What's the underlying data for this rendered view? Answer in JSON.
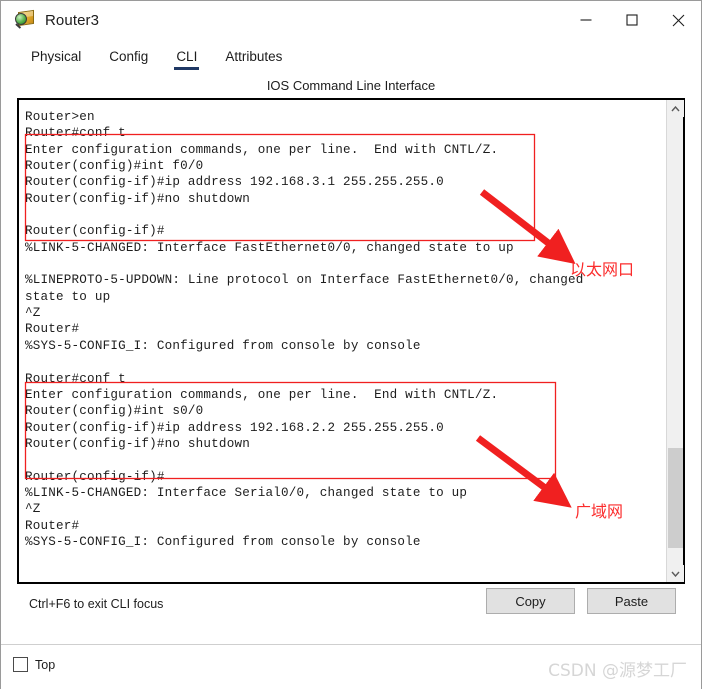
{
  "window": {
    "title": "Router3",
    "icon": "inspect-device-icon",
    "controls": {
      "minimize": "minimize-icon",
      "maximize": "maximize-icon",
      "close": "close-icon"
    }
  },
  "tabs": [
    {
      "label": "Physical",
      "active": false
    },
    {
      "label": "Config",
      "active": false
    },
    {
      "label": "CLI",
      "active": true
    },
    {
      "label": "Attributes",
      "active": false
    }
  ],
  "panel": {
    "title": "IOS Command Line Interface"
  },
  "terminal": {
    "text": "Router>en\nRouter#conf t\nEnter configuration commands, one per line.  End with CNTL/Z.\nRouter(config)#int f0/0\nRouter(config-if)#ip address 192.168.3.1 255.255.255.0\nRouter(config-if)#no shutdown\n\nRouter(config-if)#\n%LINK-5-CHANGED: Interface FastEthernet0/0, changed state to up\n\n%LINEPROTO-5-UPDOWN: Line protocol on Interface FastEthernet0/0, changed\nstate to up\n^Z\nRouter#\n%SYS-5-CONFIG_I: Configured from console by console\n\nRouter#conf t\nEnter configuration commands, one per line.  End with CNTL/Z.\nRouter(config)#int s0/0\nRouter(config-if)#ip address 192.168.2.2 255.255.255.0\nRouter(config-if)#no shutdown\n\nRouter(config-if)#\n%LINK-5-CHANGED: Interface Serial0/0, changed state to up\n^Z\nRouter#\n%SYS-5-CONFIG_I: Configured from console by console\n"
  },
  "scrollbar": {
    "up_arrow": "chevron-up-icon",
    "down_arrow": "chevron-down-icon"
  },
  "annotations": {
    "accent_color": "#fb2c2c",
    "items": [
      {
        "label": "以太网口",
        "name": "annotation-ethernet-port"
      },
      {
        "label": "广域网",
        "name": "annotation-wan"
      }
    ]
  },
  "bottom": {
    "hint": "Ctrl+F6 to exit CLI focus",
    "copy_label": "Copy",
    "paste_label": "Paste"
  },
  "footer": {
    "top_label": "Top",
    "top_checked": false,
    "watermark": "CSDN @源梦工厂"
  }
}
